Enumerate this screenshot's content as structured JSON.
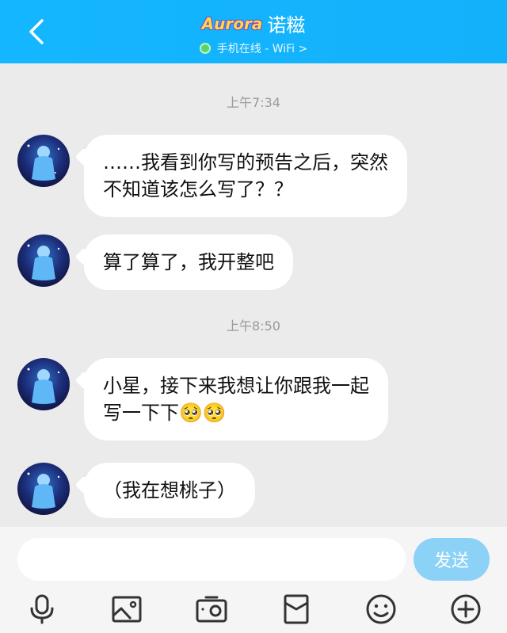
{
  "header": {
    "logo_text": "Aurora",
    "contact_name": "诺糍",
    "status_text": "手机在线 - WiFi >"
  },
  "chat": {
    "timestamps": [
      "上午7:34",
      "上午8:50"
    ],
    "messages": [
      {
        "line1": "……我看到你写的预告之后，突然",
        "line2": "不知道该怎么写了？？"
      },
      {
        "line1": "算了算了，我开整吧"
      },
      {
        "line1": "小星，接下来我想让你跟我一起",
        "line2": "写一下下🥺🥺"
      },
      {
        "line1": "（我在想桃子）"
      }
    ]
  },
  "input_bar": {
    "placeholder": "",
    "send_label": "发送"
  },
  "toolbar": {
    "icons": [
      "microphone-icon",
      "image-icon",
      "camera-icon",
      "red-packet-icon",
      "emoji-icon",
      "plus-icon"
    ]
  },
  "colors": {
    "header_bg": "#14b6ff",
    "chat_bg": "#ebebeb",
    "send_button": "#8bd2f6",
    "online_dot": "#5ad56c"
  }
}
